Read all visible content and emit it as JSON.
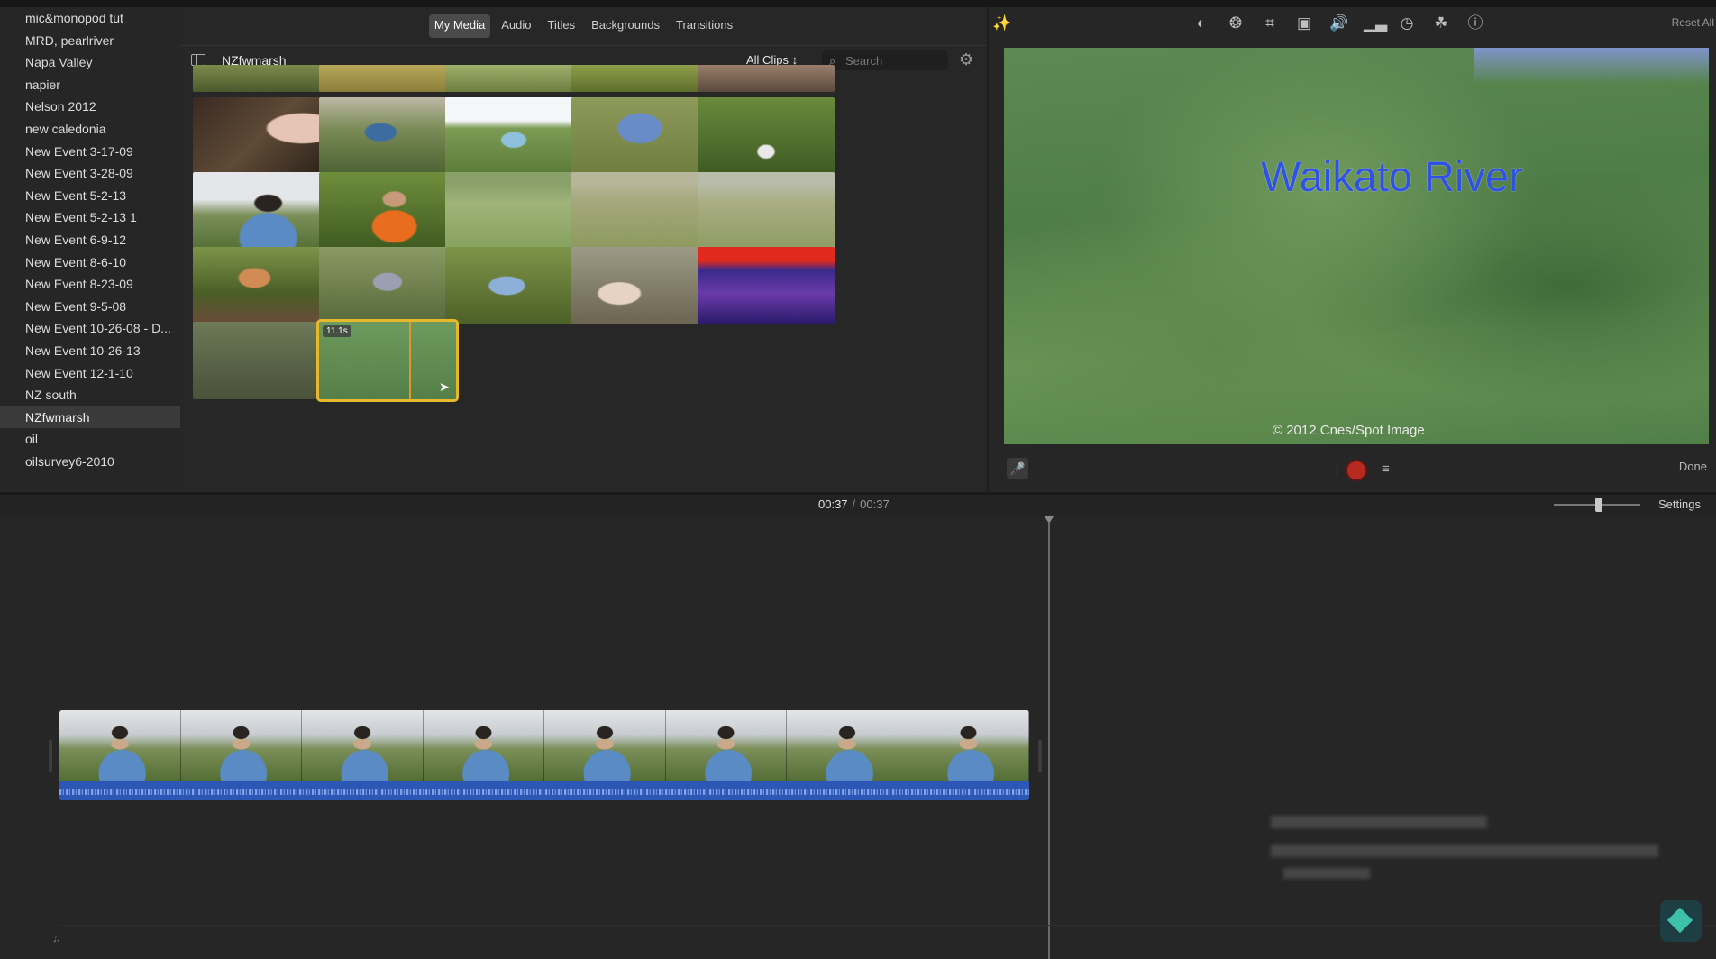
{
  "sidebar": {
    "items": [
      {
        "label": "mic&monopod tut"
      },
      {
        "label": "MRD, pearlriver"
      },
      {
        "label": "Napa Valley"
      },
      {
        "label": "napier"
      },
      {
        "label": "Nelson 2012"
      },
      {
        "label": "new caledonia"
      },
      {
        "label": "New Event 3-17-09"
      },
      {
        "label": "New Event 3-28-09"
      },
      {
        "label": "New Event 5-2-13"
      },
      {
        "label": "New Event 5-2-13 1"
      },
      {
        "label": "New Event 6-9-12"
      },
      {
        "label": "New Event 8-6-10"
      },
      {
        "label": "New Event 8-23-09"
      },
      {
        "label": "New Event 9-5-08"
      },
      {
        "label": "New Event 10-26-08 - D..."
      },
      {
        "label": "New Event 10-26-13"
      },
      {
        "label": "New Event 12-1-10"
      },
      {
        "label": "NZ south"
      },
      {
        "label": "NZfwmarsh"
      },
      {
        "label": "oil"
      },
      {
        "label": "oilsurvey6-2010"
      }
    ],
    "selected_index": 18
  },
  "media_tabs": [
    {
      "label": "My Media",
      "active": true
    },
    {
      "label": "Audio",
      "active": false
    },
    {
      "label": "Titles",
      "active": false
    },
    {
      "label": "Backgrounds",
      "active": false
    },
    {
      "label": "Transitions",
      "active": false
    }
  ],
  "browser": {
    "event_title": "NZfwmarsh",
    "filter_label": "All Clips ↕",
    "search_placeholder": "Search",
    "selected_clip_duration": "11.1s",
    "icons": {
      "sidebar_toggle": "sidebar-toggle-icon",
      "search": "search-icon",
      "settings": "gear-icon"
    }
  },
  "viewer": {
    "toolbar_icons": [
      "magic-wand-icon",
      "color-balance-icon",
      "color-correction-icon",
      "crop-icon",
      "stabilization-icon",
      "volume-icon",
      "noise-reduction-icon",
      "speed-icon",
      "clip-filter-icon",
      "info-icon"
    ],
    "reset_label": "Reset All",
    "preview_title": "Waikato River",
    "preview_credit": "© 2012 Cnes/Spot Image",
    "done_label": "Done"
  },
  "timeline": {
    "current_time": "00:37",
    "separator": "/",
    "total_time": "00:37",
    "settings_label": "Settings"
  },
  "colors": {
    "selection_outline": "#e6b82a",
    "title_text": "#2f52e4",
    "record_button": "#b8291f",
    "audio_waveform": "#2c57b5"
  }
}
